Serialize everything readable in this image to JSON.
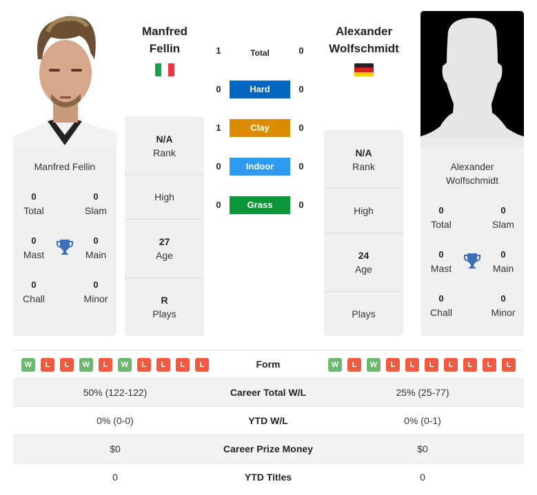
{
  "player_left": {
    "name_line1": "Manfred",
    "name_line2": "Fellin",
    "card_name": "Manfred Fellin",
    "country_flag": "italy-flag",
    "flag_colors": [
      "#009246",
      "#ffffff",
      "#ce2b37"
    ],
    "titles": {
      "total": {
        "value": "0",
        "label": "Total"
      },
      "slam": {
        "value": "0",
        "label": "Slam"
      },
      "mast": {
        "value": "0",
        "label": "Mast"
      },
      "main": {
        "value": "0",
        "label": "Main"
      },
      "chall": {
        "value": "0",
        "label": "Chall"
      },
      "minor": {
        "value": "0",
        "label": "Minor"
      }
    },
    "info": {
      "rank_value": "N/A",
      "rank_label": "Rank",
      "high_label": "High",
      "age_value": "27",
      "age_label": "Age",
      "plays_value": "R",
      "plays_label": "Plays"
    },
    "form": [
      "W",
      "L",
      "L",
      "W",
      "L",
      "W",
      "L",
      "L",
      "L",
      "L"
    ]
  },
  "player_right": {
    "name_line1": "Alexander",
    "name_line2": "Wolfschmidt",
    "card_name_line1": "Alexander",
    "card_name_line2": "Wolfschmidt",
    "country_flag": "germany-flag",
    "flag_colors": [
      "#000000",
      "#dd0000",
      "#ffce00"
    ],
    "titles": {
      "total": {
        "value": "0",
        "label": "Total"
      },
      "slam": {
        "value": "0",
        "label": "Slam"
      },
      "mast": {
        "value": "0",
        "label": "Mast"
      },
      "main": {
        "value": "0",
        "label": "Main"
      },
      "chall": {
        "value": "0",
        "label": "Chall"
      },
      "minor": {
        "value": "0",
        "label": "Minor"
      }
    },
    "info": {
      "rank_value": "N/A",
      "rank_label": "Rank",
      "high_label": "High",
      "age_value": "24",
      "age_label": "Age",
      "plays_label": "Plays"
    },
    "form": [
      "W",
      "L",
      "W",
      "L",
      "L",
      "L",
      "L",
      "L",
      "L",
      "L"
    ]
  },
  "h2h": [
    {
      "label": "Total",
      "left": "1",
      "right": "0",
      "color": null
    },
    {
      "label": "Hard",
      "left": "0",
      "right": "0",
      "color": "#0066c0"
    },
    {
      "label": "Clay",
      "left": "1",
      "right": "0",
      "color": "#dc8c00"
    },
    {
      "label": "Indoor",
      "left": "0",
      "right": "0",
      "color": "#2e9bf2"
    },
    {
      "label": "Grass",
      "left": "0",
      "right": "0",
      "color": "#0b9639"
    }
  ],
  "form_colors": {
    "W": "#6db86e",
    "L": "#ef5a43"
  },
  "comparison": {
    "form_label": "Form",
    "rows": [
      {
        "label": "Career Total W/L",
        "left": "50% (122-122)",
        "right": "25% (25-77)"
      },
      {
        "label": "YTD W/L",
        "left": "0% (0-0)",
        "right": "0% (0-1)"
      },
      {
        "label": "Career Prize Money",
        "left": "$0",
        "right": "$0"
      },
      {
        "label": "YTD Titles",
        "left": "0",
        "right": "0"
      }
    ]
  }
}
